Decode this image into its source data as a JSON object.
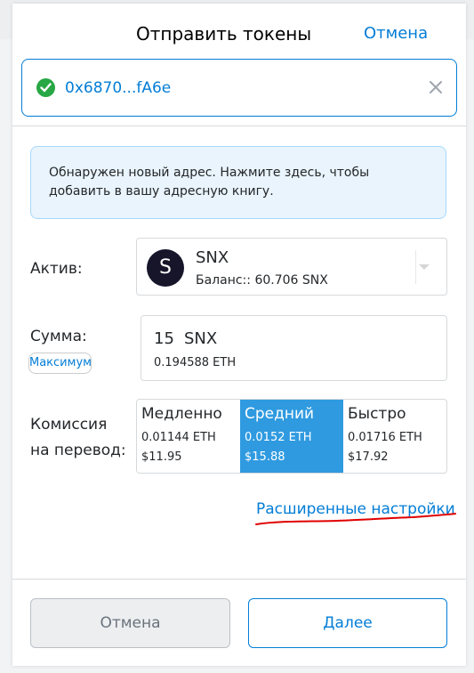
{
  "header": {
    "title": "Отправить токены",
    "cancel_label": "Отмена"
  },
  "recipient": {
    "address": "0x6870...fA6e",
    "status_icon": "check-circle-icon",
    "clear_icon": "close-icon"
  },
  "notice": {
    "text": "Обнаружен новый адрес. Нажмите здесь, чтобы добавить в вашу адресную книгу."
  },
  "asset": {
    "label": "Актив:",
    "symbol": "SNX",
    "icon_letter": "S",
    "balance": "Баланс:: 60.706 SNX"
  },
  "amount": {
    "label": "Сумма:",
    "max_label": "Максимум",
    "value": "15",
    "unit": "SNX",
    "converted": "0.194588 ETH"
  },
  "fee": {
    "label_line1": "Комиссия",
    "label_line2": "на перевод:",
    "options": [
      {
        "name": "Медленно",
        "eth": "0.01144 ETH",
        "usd": "$11.95",
        "selected": false
      },
      {
        "name": "Средний",
        "eth": "0.0152 ETH",
        "usd": "$15.88",
        "selected": true
      },
      {
        "name": "Быстро",
        "eth": "0.01716 ETH",
        "usd": "$17.92",
        "selected": false
      }
    ]
  },
  "advanced_link": "Расширенные настройки",
  "footer": {
    "cancel_label": "Отмена",
    "next_label": "Далее"
  },
  "colors": {
    "accent": "#037dd6",
    "selected_fee": "#2f9ae0",
    "success": "#28a745",
    "annotation": "#e00000"
  }
}
